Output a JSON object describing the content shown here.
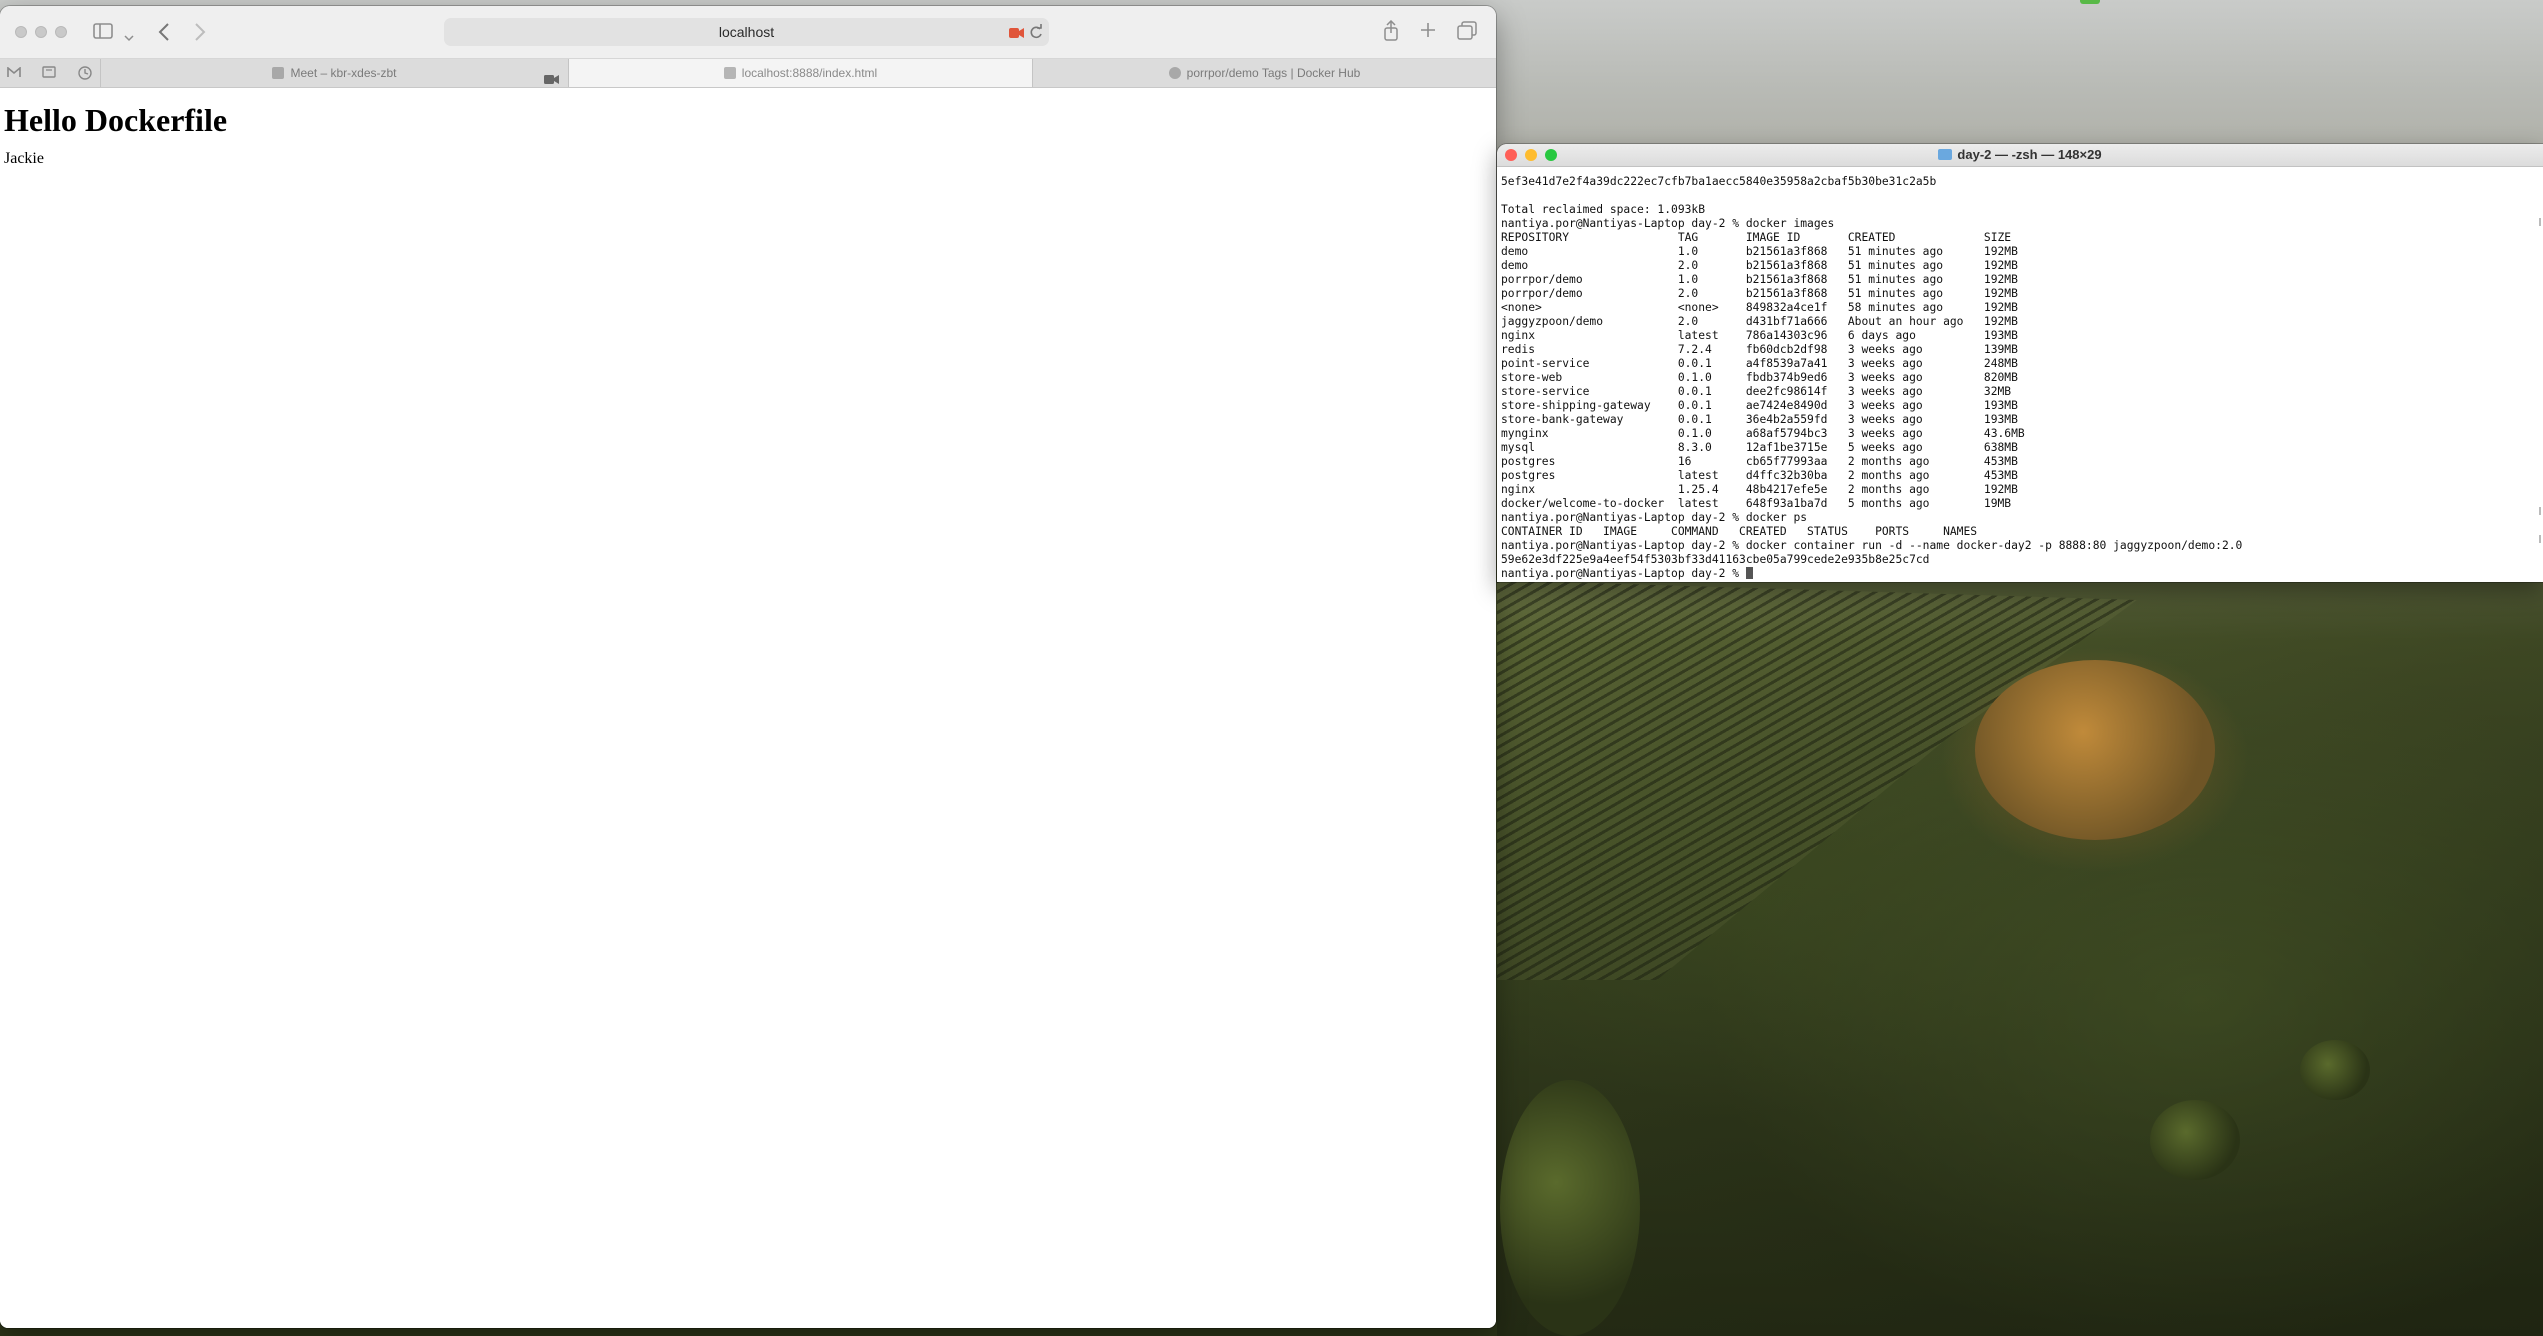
{
  "browser": {
    "address": "localhost",
    "tabs": [
      {
        "label": "Meet – kbr-xdes-zbt",
        "active": false
      },
      {
        "label": "localhost:8888/index.html",
        "active": true
      },
      {
        "label": "porrpor/demo Tags | Docker Hub",
        "active": false
      }
    ],
    "page": {
      "heading": "Hello Dockerfile",
      "paragraph": "Jackie"
    }
  },
  "terminal": {
    "title": "day-2 — -zsh — 148×29",
    "lines": [
      "5ef3e41d7e2f4a39dc222ec7cfb7ba1aecc5840e35958a2cbaf5b30be31c2a5b",
      "",
      "Total reclaimed space: 1.093kB",
      "nantiya.por@Nantiyas-Laptop day-2 % docker images",
      "REPOSITORY                TAG       IMAGE ID       CREATED             SIZE",
      "demo                      1.0       b21561a3f868   51 minutes ago      192MB",
      "demo                      2.0       b21561a3f868   51 minutes ago      192MB",
      "porrpor/demo              1.0       b21561a3f868   51 minutes ago      192MB",
      "porrpor/demo              2.0       b21561a3f868   51 minutes ago      192MB",
      "<none>                    <none>    849832a4ce1f   58 minutes ago      192MB",
      "jaggyzpoon/demo           2.0       d431bf71a666   About an hour ago   192MB",
      "nginx                     latest    786a14303c96   6 days ago          193MB",
      "redis                     7.2.4     fb60dcb2df98   3 weeks ago         139MB",
      "point-service             0.0.1     a4f8539a7a41   3 weeks ago         248MB",
      "store-web                 0.1.0     fbdb374b9ed6   3 weeks ago         820MB",
      "store-service             0.0.1     dee2fc98614f   3 weeks ago         32MB",
      "store-shipping-gateway    0.0.1     ae7424e8490d   3 weeks ago         193MB",
      "store-bank-gateway        0.0.1     36e4b2a559fd   3 weeks ago         193MB",
      "mynginx                   0.1.0     a68af5794bc3   3 weeks ago         43.6MB",
      "mysql                     8.3.0     12af1be3715e   5 weeks ago         638MB",
      "postgres                  16        cb65f77993aa   2 months ago        453MB",
      "postgres                  latest    d4ffc32b30ba   2 months ago        453MB",
      "nginx                     1.25.4    48b4217efe5e   2 months ago        192MB",
      "docker/welcome-to-docker  latest    648f93a1ba7d   5 months ago        19MB",
      "nantiya.por@Nantiyas-Laptop day-2 % docker ps",
      "CONTAINER ID   IMAGE     COMMAND   CREATED   STATUS    PORTS     NAMES",
      "nantiya.por@Nantiyas-Laptop day-2 % docker container run -d --name docker-day2 -p 8888:80 jaggyzpoon/demo:2.0",
      "59e62e3df225e9a4eef54f5303bf33d41163cbe05a799cede2e935b8e25c7cd"
    ],
    "prompt": "nantiya.por@Nantiyas-Laptop day-2 % "
  },
  "colors": {
    "close": "#ff5f57",
    "minimize": "#febc2e",
    "zoom": "#28c840",
    "record_indicator": "#e0553a"
  },
  "icons": [
    "sidebar-icon",
    "chevron-down-icon",
    "back-icon",
    "forward-icon",
    "record-icon",
    "reload-icon",
    "share-icon",
    "new-tab-icon",
    "tab-overview-icon",
    "gmail-icon",
    "reading-list-icon",
    "history-icon",
    "video-camera-icon"
  ]
}
